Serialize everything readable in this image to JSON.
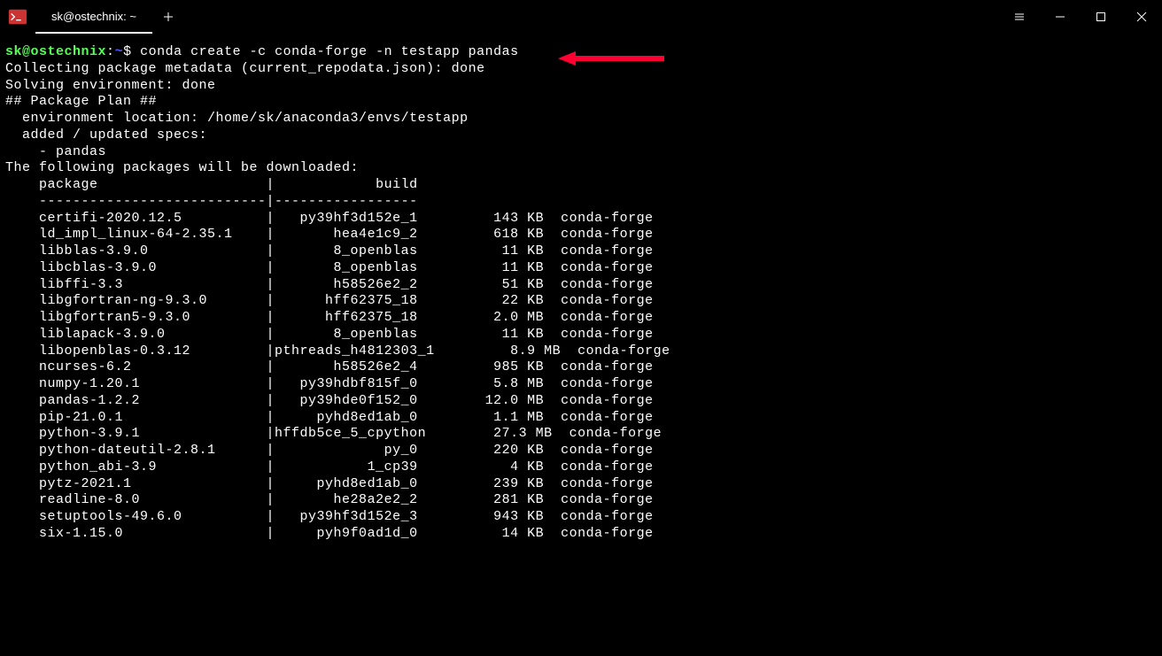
{
  "titlebar": {
    "tab_title": "sk@ostechnix: ~"
  },
  "prompt": {
    "user": "sk",
    "at": "@",
    "host": "ostechnix",
    "colon": ":",
    "path": "~",
    "dollar": "$ ",
    "command": "conda create -c conda-forge -n testapp pandas"
  },
  "output": {
    "line1": "Collecting package metadata (current_repodata.json): done",
    "line2": "Solving environment: done",
    "blank1": "",
    "line3": "## Package Plan ##",
    "blank2": "",
    "line4": "  environment location: /home/sk/anaconda3/envs/testapp",
    "blank3": "",
    "line5": "  added / updated specs:",
    "line6": "    - pandas",
    "blank4": "",
    "blank5": "",
    "line7": "The following packages will be downloaded:",
    "blank6": "",
    "header": "    package                    |            build",
    "divider": "    ---------------------------|-----------------",
    "packages": [
      "    certifi-2020.12.5          |   py39hf3d152e_1         143 KB  conda-forge",
      "    ld_impl_linux-64-2.35.1    |       hea4e1c9_2         618 KB  conda-forge",
      "    libblas-3.9.0              |       8_openblas          11 KB  conda-forge",
      "    libcblas-3.9.0             |       8_openblas          11 KB  conda-forge",
      "    libffi-3.3                 |       h58526e2_2          51 KB  conda-forge",
      "    libgfortran-ng-9.3.0       |      hff62375_18          22 KB  conda-forge",
      "    libgfortran5-9.3.0         |      hff62375_18         2.0 MB  conda-forge",
      "    liblapack-3.9.0            |       8_openblas          11 KB  conda-forge",
      "    libopenblas-0.3.12         |pthreads_h4812303_1         8.9 MB  conda-forge",
      "    ncurses-6.2                |       h58526e2_4         985 KB  conda-forge",
      "    numpy-1.20.1               |   py39hdbf815f_0         5.8 MB  conda-forge",
      "    pandas-1.2.2               |   py39hde0f152_0        12.0 MB  conda-forge",
      "    pip-21.0.1                 |     pyhd8ed1ab_0         1.1 MB  conda-forge",
      "    python-3.9.1               |hffdb5ce_5_cpython        27.3 MB  conda-forge",
      "    python-dateutil-2.8.1      |             py_0         220 KB  conda-forge",
      "    python_abi-3.9             |           1_cp39           4 KB  conda-forge",
      "    pytz-2021.1                |     pyhd8ed1ab_0         239 KB  conda-forge",
      "    readline-8.0               |       he28a2e2_2         281 KB  conda-forge",
      "    setuptools-49.6.0          |   py39hf3d152e_3         943 KB  conda-forge",
      "    six-1.15.0                 |     pyh9f0ad1d_0          14 KB  conda-forge"
    ]
  }
}
